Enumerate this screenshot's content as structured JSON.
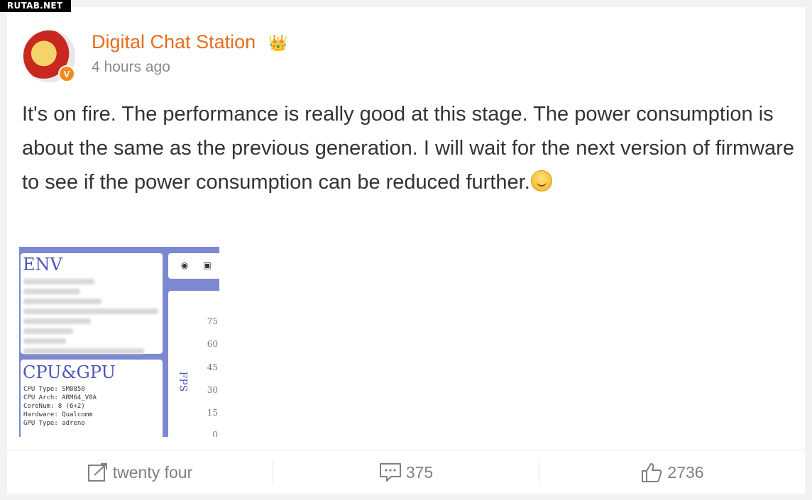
{
  "watermark": "RUTAB.NET",
  "post": {
    "author": "Digital Chat Station",
    "verified_mark": "V",
    "timestamp": "4 hours ago",
    "text": "It's on fire. The performance is really good at this stage. The power consumption is about the same as the previous generation. I will wait for the next version of firmware to see if the power consumption can be reduced further.",
    "icons": {
      "avatar": "iron-man-avatar",
      "badge": "crown-icon",
      "emoji": "smile-icon"
    }
  },
  "image": {
    "env_title": "ENV",
    "cpu_title": "CPU&GPU",
    "cpu_lines": [
      "CPU Type: SM8850",
      "CPU Arch: ARM64_V8A",
      "CoreNum: 8 (6+2)",
      "Hardware: Qualcomm",
      "GPU Type: adreno"
    ],
    "axis_label": "FPS",
    "ticks": [
      "75",
      "60",
      "45",
      "30",
      "15",
      "0"
    ]
  },
  "actions": {
    "share_label": "twenty four",
    "comment_count": "375",
    "like_count": "2736"
  }
}
